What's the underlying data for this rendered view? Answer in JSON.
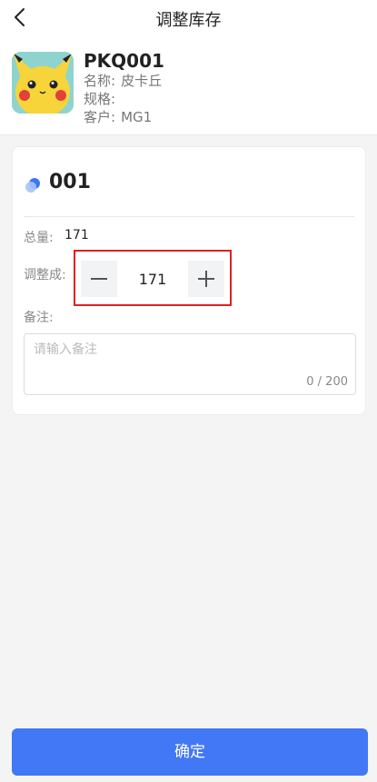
{
  "header": {
    "title": "调整库存",
    "back_icon": "chevron-left-icon"
  },
  "product": {
    "code": "PKQ001",
    "name_label": "名称:",
    "name_value": "皮卡丘",
    "spec_label": "规格:",
    "spec_value": "",
    "customer_label": "客户:",
    "customer_value": "MG1"
  },
  "location": {
    "icon": "location-dot-icon",
    "code": "001",
    "total_label": "总量:",
    "total_value": "171",
    "adjust_label": "调整成:",
    "adjust_value": "171",
    "remark_label": "备注:",
    "remark_placeholder": "请输入备注",
    "remark_count": "0 / 200"
  },
  "footer": {
    "confirm_label": "确定"
  },
  "colors": {
    "primary": "#4277f5",
    "highlight": "#e02020"
  }
}
